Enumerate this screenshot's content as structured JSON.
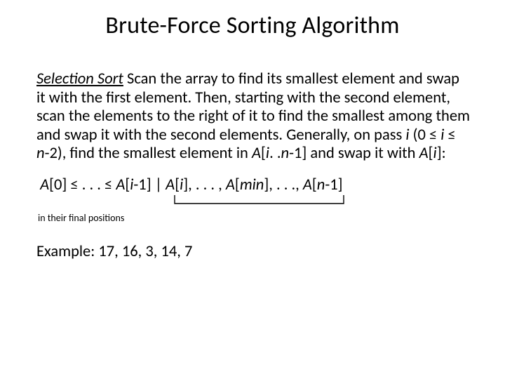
{
  "title": "Brute-Force Sorting Algorithm",
  "term": "Selection Sort",
  "desc_pre": "   Scan the array to find its smallest element and swap it with the first element.  Then, starting with the second element, scan the elements to the right of it to find the smallest among them and swap it with the second elements.  Generally, on pass ",
  "desc_i1": "i",
  "desc_mid1": " (0 ≤ ",
  "desc_i2": "i",
  "desc_mid2": " ≤ ",
  "desc_n1": "n",
  "desc_mid3": "-2), find the smallest element in ",
  "desc_Arange": "A",
  "desc_mid4": "[",
  "desc_i3": "i",
  "desc_mid5": ". .",
  "desc_n2": "n",
  "desc_mid6": "-1] and swap it with ",
  "desc_A2": "A",
  "desc_mid7": "[",
  "desc_i4": "i",
  "desc_mid8": "]:",
  "f_A0": "A",
  "f_t1": "[0]  ≤   .   .   .  ≤ ",
  "f_A1": "A",
  "f_t2": "[",
  "f_i1": "i",
  "f_t3": "-1]  |  ",
  "f_A2": "A",
  "f_t4": "[",
  "f_i2": "i",
  "f_t5": "],  .   .   .  , ",
  "f_A3": "A",
  "f_t6": "[",
  "f_min": "min",
  "f_t7": "], .   .   ., ",
  "f_A4": "A",
  "f_t8": "[",
  "f_n": "n",
  "f_t9": "-1]",
  "caption": "in their final positions",
  "example": "Example: 17, 16, 3, 14, 7"
}
